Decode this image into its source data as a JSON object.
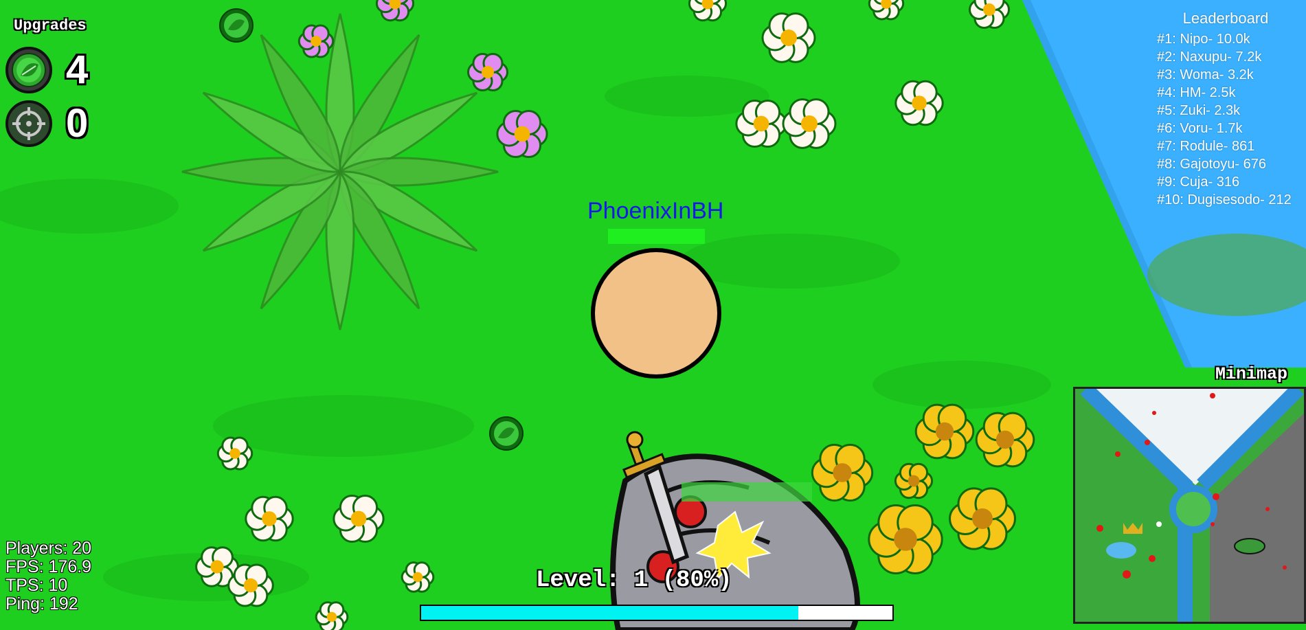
{
  "hud": {
    "upgrades_title": "Upgrades",
    "leaf_count": "4",
    "target_count": "0",
    "leaf_icon": "leaf-icon",
    "target_icon": "crosshair-icon"
  },
  "player": {
    "name": "PhoenixInBH",
    "health_fraction": 1.0,
    "body_color": "#f2c187",
    "name_color": "#1818e8"
  },
  "level": {
    "label": "Level: 1 (80%)",
    "xp_fraction": 0.8,
    "bar_color": "#00f2f2"
  },
  "leaderboard": {
    "title": "Leaderboard",
    "entries": [
      "#1: Nipo- 10.0k",
      "#2: Naxupu- 7.2k",
      "#3: Woma- 3.2k",
      "#4: HM- 2.5k",
      "#5: Zuki- 2.3k",
      "#6: Voru- 1.7k",
      "#7: Rodule- 861",
      "#8: Gajotoyu- 676",
      "#9: Cuja- 316",
      "#10: Dugisesodo- 212"
    ]
  },
  "stats": {
    "players": "Players: 20",
    "fps": "FPS: 176.9",
    "tps": "TPS: 10",
    "ping": "Ping: 192"
  },
  "minimap": {
    "title": "Minimap"
  },
  "colors": {
    "grass": "#1fcf1f",
    "water": "#3ab0ff",
    "flower_white": "#fff8ee",
    "flower_yellow": "#f5c518",
    "flower_purple": "#e08cf0"
  }
}
